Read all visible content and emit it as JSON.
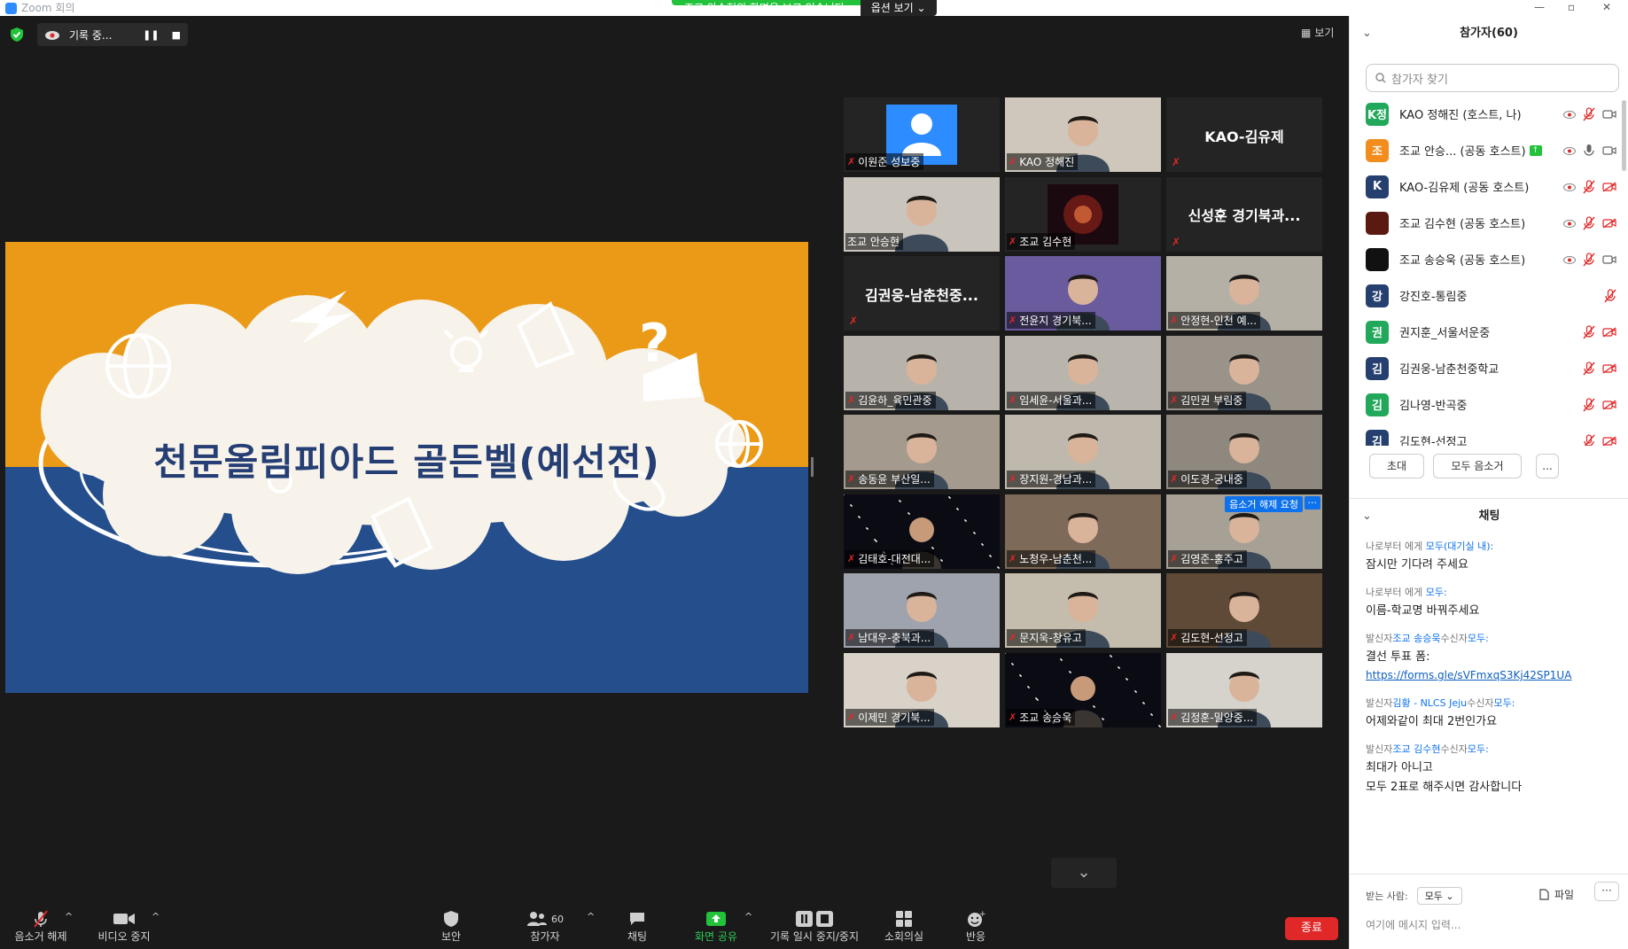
{
  "window": {
    "title": "Zoom 회의",
    "share_banner": "조교 안승현의 화면을 보고 있습니다.",
    "options_label": "옵션 보기 ⌄"
  },
  "recording": {
    "label": "기록 중..."
  },
  "view_label": "보기",
  "slide": {
    "title": "천문올림피아드 골든벨(예선전)",
    "colors": {
      "top": "#eb9a17",
      "bottom": "#254e8d",
      "title": "#253e74"
    }
  },
  "gallery": {
    "tiles": [
      {
        "name": "이원준 성보중",
        "kind": "avatar"
      },
      {
        "name": "KAO 정해진",
        "kind": "video",
        "bg": "#cfc7bb"
      },
      {
        "name": "KAO-김유제",
        "kind": "name"
      },
      {
        "name": "조교 안승현",
        "kind": "video",
        "bg": "#c9c5bd",
        "active": true
      },
      {
        "name": "조교 김수현",
        "kind": "nebula"
      },
      {
        "name": "신성훈 경기북과...",
        "kind": "name"
      },
      {
        "name": "김권웅-남춘천중...",
        "kind": "name"
      },
      {
        "name": "전윤지 경기북...",
        "kind": "video",
        "bg": "#6a5b9e"
      },
      {
        "name": "안정현-인천 예...",
        "kind": "video",
        "bg": "#b5b0a6"
      },
      {
        "name": "김윤하_육민관중",
        "kind": "video",
        "bg": "#b8b3aa"
      },
      {
        "name": "임세윤-서울과...",
        "kind": "video",
        "bg": "#b9b5ad"
      },
      {
        "name": "김민권 부림중",
        "kind": "video",
        "bg": "#9a938a"
      },
      {
        "name": "송동윤 부산일...",
        "kind": "video",
        "bg": "#a49b8e"
      },
      {
        "name": "장지원-경남과...",
        "kind": "video",
        "bg": "#bfb8ac"
      },
      {
        "name": "이도경-궁내중",
        "kind": "video",
        "bg": "#8f887e"
      },
      {
        "name": "김태호-대전대...",
        "kind": "space"
      },
      {
        "name": "노청우-남춘천...",
        "kind": "video",
        "bg": "#7e6a58"
      },
      {
        "name": "김영준-홍주고",
        "kind": "video",
        "bg": "#a7a095",
        "unmute_request": "음소거 해제 요청"
      },
      {
        "name": "남대우-충북과...",
        "kind": "video",
        "bg": "#9fa3ad"
      },
      {
        "name": "문지욱-창유고",
        "kind": "video",
        "bg": "#c4bcac"
      },
      {
        "name": "김도현-선정고",
        "kind": "video",
        "bg": "#5e4a36"
      },
      {
        "name": "이제민 경기북...",
        "kind": "video",
        "bg": "#d8d2c8"
      },
      {
        "name": "조교 송승욱",
        "kind": "space"
      },
      {
        "name": "김정훈-밀양중...",
        "kind": "video",
        "bg": "#d6d2cc"
      }
    ]
  },
  "toolbar": {
    "unmute": "음소거 해제",
    "video_stop": "비디오 중지",
    "security": "보안",
    "participants": "참가자",
    "participants_count": "60",
    "chat": "채팅",
    "share": "화면 공유",
    "record": "기록 일시 중지/중지",
    "breakout": "소회의실",
    "reactions": "반응",
    "end": "종료"
  },
  "panel": {
    "participants_title": "참가자(60)",
    "search_placeholder": "참가자 찾기",
    "participants": [
      {
        "initial": "K정",
        "color": "#22a85a",
        "name": "KAO 정해진 (호스트, 나)",
        "rec": true,
        "mic": "muted",
        "cam": "on"
      },
      {
        "initial": "조",
        "color": "#f28c1c",
        "name": "조교 안승... (공동 호스트)",
        "share": true,
        "rec": true,
        "mic": "on",
        "cam": "on"
      },
      {
        "initial": "K",
        "color": "#25406f",
        "name": "KAO-김유제 (공동 호스트)",
        "rec": true,
        "mic": "muted",
        "cam": "off"
      },
      {
        "initial": "",
        "color": "#5a1a12",
        "name": "조교 김수현 (공동 호스트)",
        "rec": true,
        "mic": "muted",
        "cam": "off"
      },
      {
        "initial": "",
        "color": "#111111",
        "name": "조교 송승욱 (공동 호스트)",
        "rec": true,
        "mic": "muted",
        "cam": "on"
      },
      {
        "initial": "강",
        "color": "#25406f",
        "name": "강진호-통림중",
        "mic": "muted"
      },
      {
        "initial": "권",
        "color": "#22a85a",
        "name": "권지훈_서울서운중",
        "mic": "muted",
        "cam": "off"
      },
      {
        "initial": "김",
        "color": "#25406f",
        "name": "김권웅-남춘천중학교",
        "mic": "muted",
        "cam": "off"
      },
      {
        "initial": "김",
        "color": "#22a85a",
        "name": "김나영-반곡중",
        "mic": "muted",
        "cam": "off"
      },
      {
        "initial": "김",
        "color": "#25406f",
        "name": "김도현-선정고",
        "mic": "muted",
        "cam": "off"
      }
    ],
    "invite": "초대",
    "mute_all": "모두 음소거",
    "more": "...",
    "chat_title": "채팅",
    "messages": [
      {
        "meta_a": "나로부터 에게 ",
        "meta_b": "모두(대기실 내):",
        "meta_c": "",
        "meta_d": "",
        "body": "잠시만 기다려 주세요"
      },
      {
        "meta_a": "나로부터 에게 ",
        "meta_b": "모두:",
        "meta_c": "",
        "meta_d": "",
        "body": "이름-학교명 바꿔주세요"
      },
      {
        "meta_a": "발신자",
        "meta_b": "조교 송승욱",
        "meta_c": "수신자",
        "meta_d": "모두:",
        "body": "결선 투표 폼:",
        "link": "https://forms.gle/sVFmxqS3Kj42SP1UA"
      },
      {
        "meta_a": "발신자",
        "meta_b": "김황 - NLCS Jeju",
        "meta_c": "수신자",
        "meta_d": "모두:",
        "body": "어제와같이 최대 2번인가요"
      },
      {
        "meta_a": "발신자",
        "meta_b": "조교 김수현",
        "meta_c": "수신자",
        "meta_d": "모두:",
        "body": "최대가 아니고",
        "body2": "모두 2표로 해주시면 감사합니다"
      }
    ],
    "to_label": "받는 사람:",
    "to_value": "모두 ⌄",
    "file_label": "파일",
    "input_placeholder": "여기에 메시지 입력..."
  }
}
